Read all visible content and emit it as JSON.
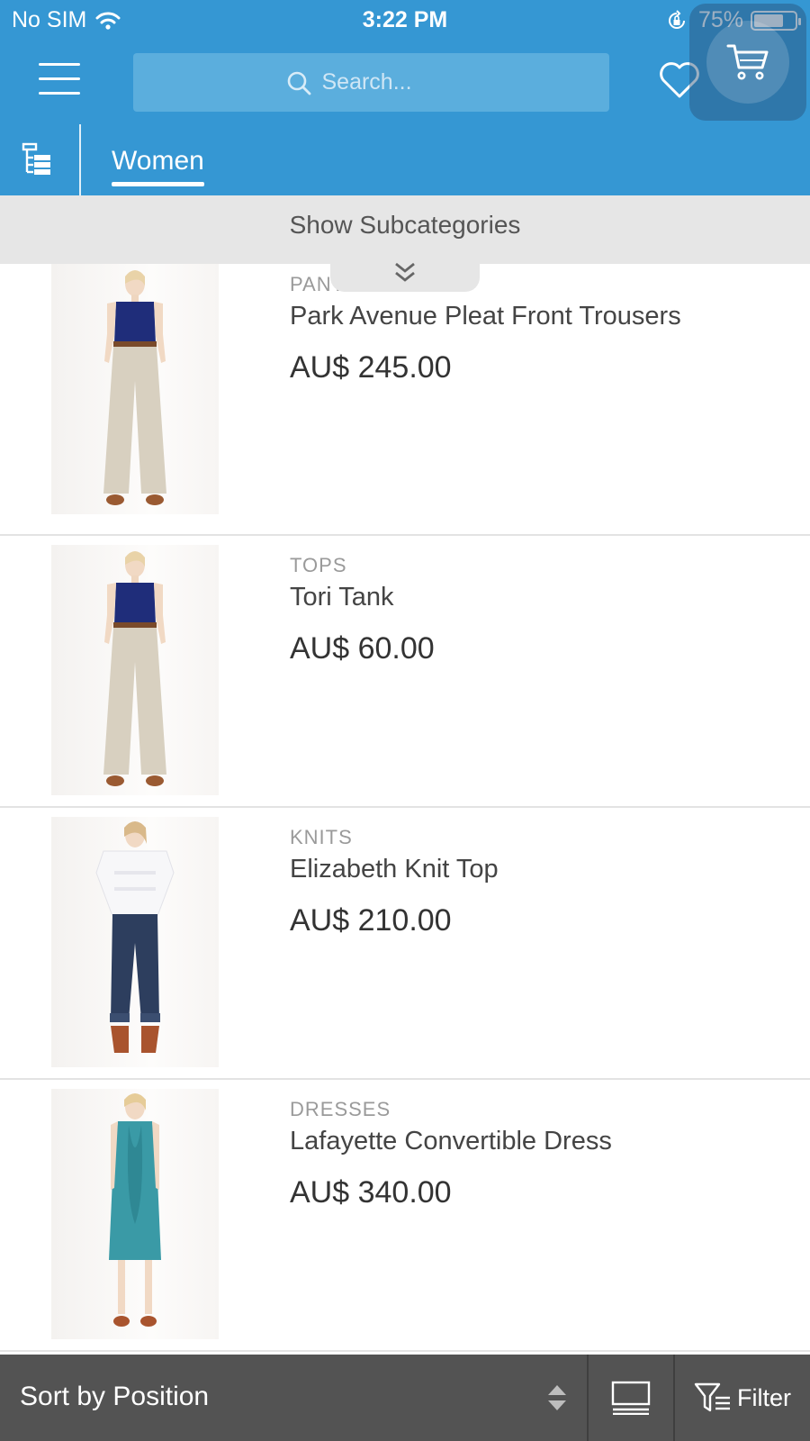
{
  "status_bar": {
    "carrier": "No SIM",
    "time": "3:22 PM",
    "battery": "75%",
    "battery_level": 0.75
  },
  "header": {
    "search_placeholder": "Search...",
    "category_tab": "Women"
  },
  "subcategories": {
    "label": "Show Subcategories"
  },
  "products": [
    {
      "category": "PANTS",
      "name": "Park Avenue Pleat Front Trousers",
      "price": "AU$ 245.00",
      "image": "model-navy-tank-beige-trousers"
    },
    {
      "category": "TOPS",
      "name": "Tori Tank",
      "price": "AU$ 60.00",
      "image": "model-navy-tank-beige-trousers"
    },
    {
      "category": "KNITS",
      "name": "Elizabeth Knit Top",
      "price": "AU$ 210.00",
      "image": "model-white-knit-top-jeans"
    },
    {
      "category": "DRESSES",
      "name": "Lafayette Convertible Dress",
      "price": "AU$ 340.00",
      "image": "model-teal-dress"
    }
  ],
  "toolbar": {
    "sort_label": "Sort by Position",
    "filter_label": "Filter"
  },
  "icons": {
    "wifi": "wifi-icon",
    "lock": "orientation-lock-icon",
    "menu": "hamburger-menu-icon",
    "search": "search-icon",
    "wishlist": "heart-icon",
    "cart": "cart-icon",
    "categories": "category-tree-icon",
    "expand": "double-chevron-down-icon",
    "sort": "sort-arrows-icon",
    "view": "list-view-icon",
    "filter": "filter-icon"
  },
  "colors": {
    "header_blue": "#3597d3",
    "search_bg": "#5baedd",
    "subcat_bg": "#e6e6e6",
    "toolbar_bg": "#535353"
  }
}
